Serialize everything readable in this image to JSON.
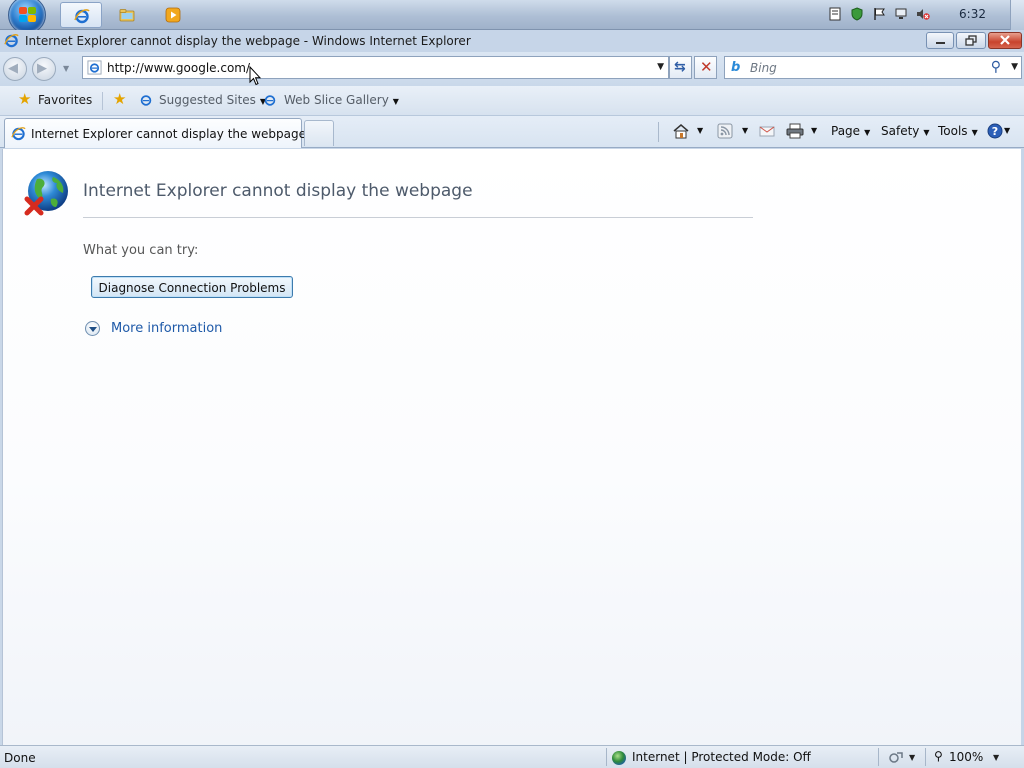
{
  "taskbar": {
    "start_button": "start-orb",
    "pinned": [
      {
        "name": "internet-explorer",
        "active": true
      },
      {
        "name": "windows-explorer",
        "active": false
      },
      {
        "name": "media-player",
        "active": false
      }
    ],
    "clock": "6:32"
  },
  "window": {
    "title": "Internet Explorer cannot display the webpage - Windows Internet Explorer"
  },
  "navigation": {
    "address_url": "http://www.google.com/",
    "search_placeholder": "Bing"
  },
  "favorites_bar": {
    "favorites_label": "Favorites",
    "items": [
      {
        "label": "Suggested Sites"
      },
      {
        "label": "Web Slice Gallery"
      }
    ]
  },
  "tab": {
    "label": "Internet Explorer cannot display the webpage"
  },
  "command_bar": {
    "page_label": "Page",
    "safety_label": "Safety",
    "tools_label": "Tools"
  },
  "content": {
    "error_title": "Internet Explorer cannot display the webpage",
    "try_label": "What you can try:",
    "diagnose_button": "Diagnose Connection Problems",
    "more_info_label": "More information"
  },
  "status_bar": {
    "status": "Done",
    "zone": "Internet | Protected Mode: Off",
    "zoom": "100%"
  },
  "colors": {
    "chrome": "#c6d5e8",
    "link": "#1f5aa8",
    "close_button": "#c8432d"
  }
}
